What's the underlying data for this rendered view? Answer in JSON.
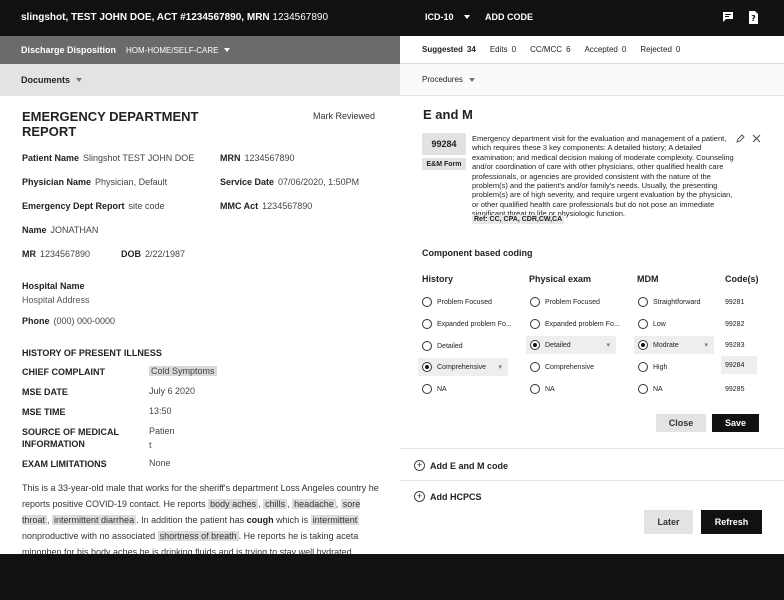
{
  "topbar": {
    "patient_name": "slingshot, TEST JOHN DOE",
    "act_label": "ACT",
    "act_value": "#1234567890",
    "mrn_label": "MRN",
    "mrn_value": "1234567890",
    "icd_label": "ICD-10",
    "add_code": "ADD CODE",
    "icons": [
      "chat-icon",
      "help-icon"
    ]
  },
  "left": {
    "dispo_label": "Discharge Disposition",
    "dispo_value": "HOM-HOME/SELF-CARE",
    "documents_label": "Documents",
    "report_title": "EMERGENCY DEPARTMENT REPORT",
    "mark_reviewed": "Mark Reviewed",
    "fields": {
      "patient_name_label": "Patient Name",
      "patient_name_value": "Slingshot  TEST JOHN DOE",
      "mrn_label": "MRN",
      "mrn_value": "1234567890",
      "physician_label": "Physician Name",
      "physician_value": "Physician, Default",
      "service_date_label": "Service Date",
      "service_date_value": "07/06/2020, 1:50PM",
      "edr_label": "Emergency Dept Report",
      "edr_value": "site code",
      "mmc_label": "MMC Act",
      "mmc_value": "1234567890",
      "name_label": "Name",
      "name_value": "JONATHAN",
      "mr_label": "MR",
      "mr_value": "1234567890",
      "dob_label": "DOB",
      "dob_value": "2/22/1987",
      "hospital_name": "Hospital Name",
      "hospital_address": "Hospital Address",
      "phone_label": "Phone",
      "phone_value": "(000) 000-0000"
    },
    "hpi_title": "HISTORY OF PRESENT ILLNESS",
    "kv": {
      "chief_complaint_label": "CHIEF COMPLAINT",
      "chief_complaint_value": "Cold Symptoms",
      "mse_date_label": "MSE DATE",
      "mse_date_value": "July 6 2020",
      "mse_time_label": "MSE TIME",
      "mse_time_value": "13:50",
      "source_label": "SOURCE OF MEDICAL INFORMATION",
      "source_value_1": "Patien",
      "source_value_2": "t",
      "exam_label": "EXAM LIMITATIONS",
      "exam_value": "None"
    },
    "hpi": {
      "t1": "This is a 33-year-old male that works for the sheriff's department Loss Angeles country he reports positive COVID-19 contact. He reports ",
      "h1": "body aches",
      "t2": ", ",
      "h2": "chills",
      "t3": ", ",
      "h3": "headache",
      "t4": ", ",
      "h4": "sore throat",
      "t5": ", ",
      "h5": "intermittent diarrhea",
      "t6": ". In addition the patient has ",
      "b1": "cough",
      "t7": " which is ",
      "h6": "intermittent",
      "t8": " nonproductive with no associated ",
      "h7": "shortness of breath",
      "t9": ". He reports he is taking aceta minophen for his body aches he is drinking fluids and is trying to stay well hydrated."
    }
  },
  "right": {
    "stats": [
      {
        "label": "Suggested",
        "value": "34"
      },
      {
        "label": "Edits",
        "value": "0"
      },
      {
        "label": "CC/MCC",
        "value": "6"
      },
      {
        "label": "Accepted",
        "value": "0"
      },
      {
        "label": "Rejected",
        "value": "0"
      }
    ],
    "procedures_label": "Procedures",
    "em_title": "E and M",
    "code": "99284",
    "em_form": "E&M Form",
    "description": "Emergency department visit for the evaluation and management of a patient, which requires these 3 key components: A detailed history; A detailed examination; and medical decision making of moderate complexity. Counseling and/or coordination of care with other physicians, other qualified health care professionals, or agencies are provided consistent with the nature of the problem(s) and the patient's and/or family's needs. Usually, the presenting problem(s) are of high severity, and require urgent evaluation by the physician, or other qualified health care professionals but do not pose an immediate significant threat to life or physiologic function.",
    "ref": "Ref: CC, CPA, CDR,CW,CA",
    "component_title": "Component based coding",
    "columns": {
      "history": "History",
      "exam": "Physical exam",
      "mdm": "MDM",
      "codes": "Code(s)"
    },
    "history_opts": [
      "Problem Focused",
      "Expanded problem Fo...",
      "Detailed",
      "Comprehensive",
      "NA"
    ],
    "exam_opts": [
      "Problem Focused",
      "Expanded problem Fo...",
      "Detailed",
      "Comprehensive",
      "NA"
    ],
    "mdm_opts": [
      "Straightforward",
      "Low",
      "Modrate",
      "High",
      "NA"
    ],
    "codes": [
      "99281",
      "99282",
      "99283",
      "99284",
      "99285"
    ],
    "close_label": "Close",
    "save_label": "Save",
    "add_em": "Add E and M code",
    "add_hcpcs": "Add HCPCS",
    "later_label": "Later",
    "refresh_label": "Refresh"
  }
}
